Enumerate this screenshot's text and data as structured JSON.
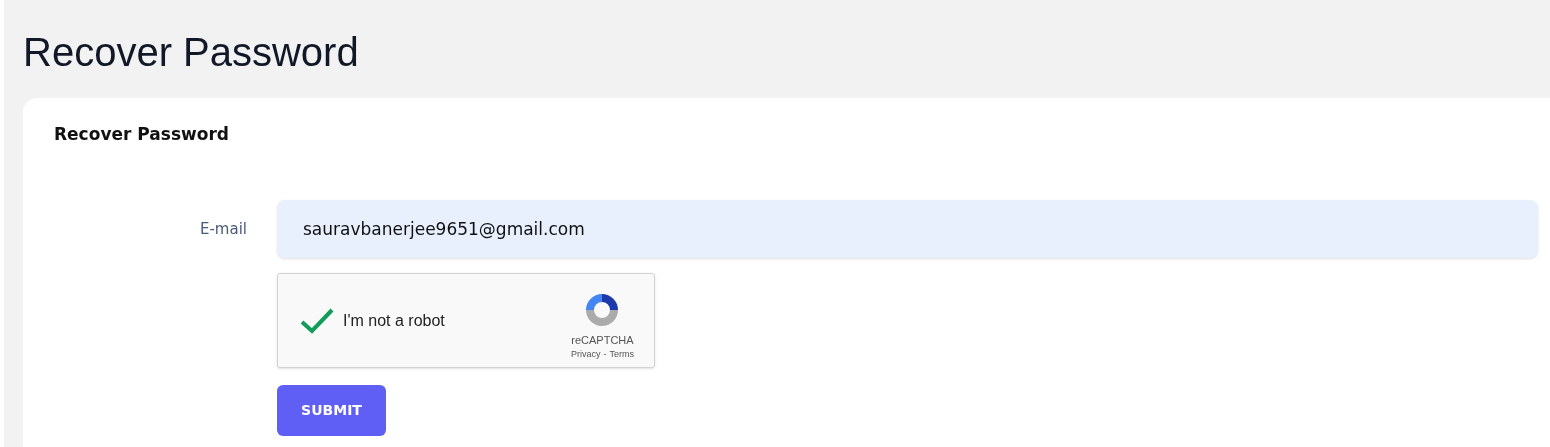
{
  "page_title": "Recover Password",
  "card": {
    "title": "Recover Password",
    "email": {
      "label": "E-mail",
      "value": "sauravbanerjee9651@gmail.com"
    },
    "captcha": {
      "label": "I'm not a robot",
      "checked": true,
      "brand": "reCAPTCHA",
      "links": [
        "Privacy",
        "Terms"
      ],
      "separator": "-"
    },
    "submit": "SUBMIT"
  }
}
